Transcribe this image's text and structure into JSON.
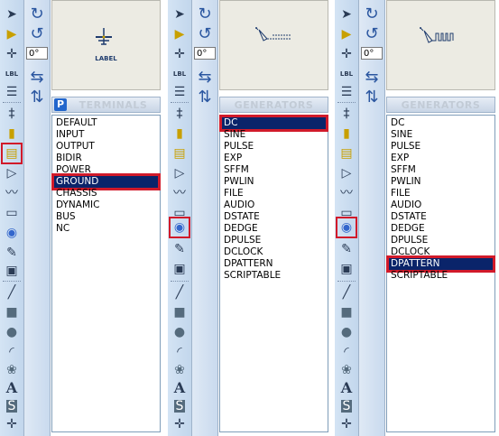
{
  "panels": [
    {
      "id": "terminals",
      "header_tag": "P",
      "header_title": "TERMINALS",
      "preview_caption": "LABEL",
      "rotation_value": "0°",
      "highlighted_tool": "terminals-mode",
      "items": [
        "DEFAULT",
        "INPUT",
        "OUTPUT",
        "BIDIR",
        "POWER",
        "GROUND",
        "CHASSIS",
        "DYNAMIC",
        "BUS",
        "NC"
      ],
      "selected": "GROUND"
    },
    {
      "id": "generators-dc",
      "header_tag": "",
      "header_title": "GENERATORS",
      "preview_caption": "",
      "rotation_value": "0°",
      "highlighted_tool": "generator-mode",
      "items": [
        "DC",
        "SINE",
        "PULSE",
        "EXP",
        "SFFM",
        "PWLIN",
        "FILE",
        "AUDIO",
        "DSTATE",
        "DEDGE",
        "DPULSE",
        "DCLOCK",
        "DPATTERN",
        "SCRIPTABLE"
      ],
      "selected": "DC"
    },
    {
      "id": "generators-dpattern",
      "header_tag": "",
      "header_title": "GENERATORS",
      "preview_caption": "",
      "rotation_value": "0°",
      "highlighted_tool": "generator-mode",
      "items": [
        "DC",
        "SINE",
        "PULSE",
        "EXP",
        "SFFM",
        "PWLIN",
        "FILE",
        "AUDIO",
        "DSTATE",
        "DEDGE",
        "DPULSE",
        "DCLOCK",
        "DPATTERN",
        "SCRIPTABLE"
      ],
      "selected": "DPATTERN"
    }
  ],
  "toolbar_icons": [
    "selection-icon",
    "component-icon",
    "junction-dot-icon",
    "wire-label-icon",
    "text-script-icon",
    "bus-icon",
    "subcircuit-icon",
    "terminals-icon",
    "device-pins-icon",
    "graph-icon",
    "tape-recorder-icon",
    "generator-icon",
    "voltage-probe-icon",
    "virtual-instruments-icon",
    "line-icon",
    "box-icon",
    "circle-icon",
    "arc-icon",
    "path-icon",
    "text-icon",
    "symbol-icon",
    "marker-icon"
  ],
  "side_icons": [
    "rotate-clockwise-icon",
    "rotate-anticlockwise-icon",
    "flip-horizontal-icon",
    "flip-vertical-icon"
  ],
  "colors": {
    "selection_bg": "#0a246a",
    "highlight_outline": "#d11a2a"
  }
}
